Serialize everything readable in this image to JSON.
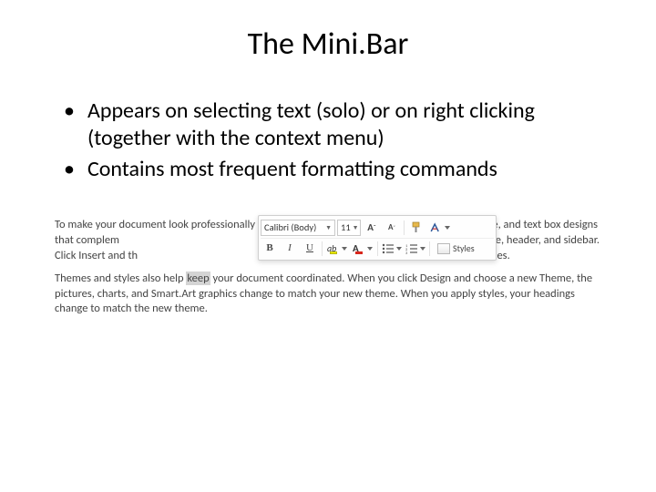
{
  "title": "The Mini.Bar",
  "bullets": [
    "Appears on selecting text (solo) or on right clicking (together with the context menu)",
    "Contains most frequent formatting commands"
  ],
  "doc": {
    "p1a": "To make your document look professionally produced, Word provides header, footer, cover page, and text box designs that complem",
    "p1b": "n add a matching cover page, header, and sidebar. Click Insert and th",
    "p1c": "rom the different galleries.",
    "p2a": "Themes and styles also help ",
    "p2sel": "keep",
    "p2b": " your document coordinated. When you click Design and choose a new Theme, the pictures, charts, and Smart.Art graphics change to match your new theme. When you apply styles, your headings change to match the new theme."
  },
  "minibar": {
    "font": "Calibri (Body)",
    "size": "11",
    "growA": "A",
    "shrinkA": "A",
    "B": "B",
    "I": "I",
    "U": "U",
    "hlGlyph": "ab",
    "fcGlyph": "A",
    "styles": "Styles"
  }
}
